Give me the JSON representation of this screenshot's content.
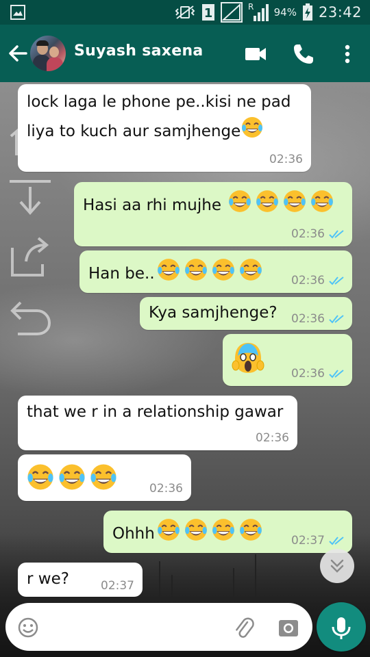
{
  "status_bar": {
    "sim_slot": "1",
    "roaming": "R",
    "battery": "94%",
    "time": "23:42"
  },
  "header": {
    "contact_name": "Suyash saxena",
    "icons": [
      "back-arrow-icon",
      "video-call-icon",
      "phone-call-icon",
      "more-options-icon"
    ]
  },
  "messages": [
    {
      "direction": "in",
      "text": "lock laga le phone pe..kisi ne pad liya to kuch aur samjhenge",
      "emoji": [
        "tears-of-joy"
      ],
      "time": "02:36"
    },
    {
      "direction": "out",
      "text": "Hasi aa rhi mujhe ",
      "emoji": [
        "tears-of-joy",
        "tears-of-joy",
        "tears-of-joy",
        "tears-of-joy"
      ],
      "time": "02:36",
      "status": "read"
    },
    {
      "direction": "out",
      "text": "Han be..",
      "emoji": [
        "tears-of-joy",
        "tears-of-joy",
        "tears-of-joy",
        "tears-of-joy"
      ],
      "time": "02:36",
      "status": "read"
    },
    {
      "direction": "out",
      "text": "Kya samjhenge?",
      "emoji": [],
      "time": "02:36",
      "status": "read"
    },
    {
      "direction": "out",
      "text": "",
      "emoji": [
        "screaming-face"
      ],
      "time": "02:36",
      "status": "read"
    },
    {
      "direction": "in",
      "text": "that we r in a relationship gawar",
      "emoji": [],
      "time": "02:36"
    },
    {
      "direction": "in",
      "text": "",
      "emoji": [
        "tears-of-joy",
        "tears-of-joy",
        "tears-of-joy"
      ],
      "time": "02:36"
    },
    {
      "direction": "out",
      "text": "Ohhh",
      "emoji": [
        "tears-of-joy",
        "tears-of-joy",
        "tears-of-joy",
        "tears-of-joy"
      ],
      "time": "02:37",
      "status": "read"
    },
    {
      "direction": "in",
      "text": "r we?",
      "emoji": [],
      "time": "02:37"
    }
  ],
  "input": {
    "placeholder": "",
    "value": "",
    "icons": [
      "emoji-icon",
      "attach-icon",
      "camera-icon",
      "mic-icon"
    ]
  },
  "colors": {
    "status_bar": "#054d44",
    "app_bar": "#075e54",
    "outgoing_bubble": "#dcf8c6",
    "incoming_bubble": "#ffffff",
    "read_ticks": "#4fc3f7",
    "mic_button": "#128c7e"
  }
}
